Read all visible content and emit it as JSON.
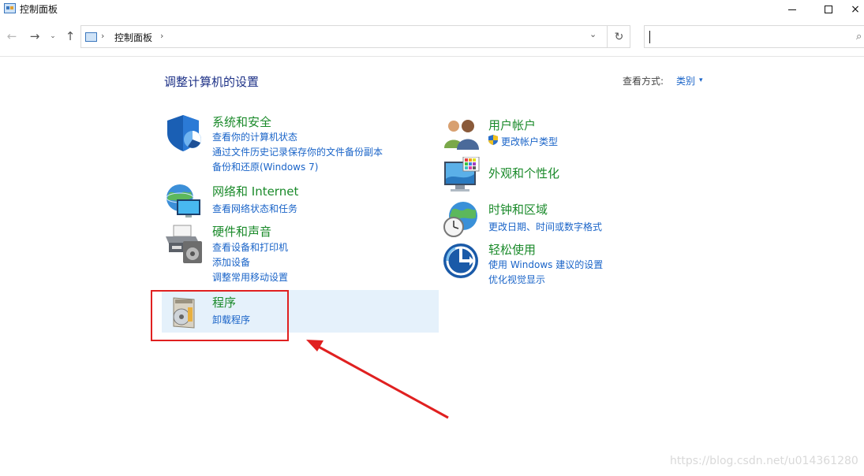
{
  "window": {
    "title": "控制面板",
    "minimize": "—",
    "close": "×"
  },
  "nav": {
    "back": "←",
    "forward": "→",
    "recent": "⌄",
    "up": "↑",
    "breadcrumb": "控制面板",
    "separator": "›",
    "dropdown": "⌄",
    "refresh": "↻",
    "search_placeholder": "",
    "search_icon": "⌕"
  },
  "content": {
    "page_title": "调整计算机的设置",
    "view_by_label": "查看方式:",
    "view_by_value": "类别",
    "view_by_arrow": "▾"
  },
  "categories_left": [
    {
      "title": "系统和安全",
      "icon": "shield-icon",
      "links": [
        "查看你的计算机状态",
        "通过文件历史记录保存你的文件备份副本",
        "备份和还原(Windows 7)"
      ]
    },
    {
      "title": "网络和 Internet",
      "icon": "network-icon",
      "links": [
        "查看网络状态和任务"
      ]
    },
    {
      "title": "硬件和声音",
      "icon": "printer-icon",
      "links": [
        "查看设备和打印机",
        "添加设备",
        "调整常用移动设置"
      ]
    },
    {
      "title": "程序",
      "icon": "programs-icon",
      "links": [
        "卸载程序"
      ]
    }
  ],
  "categories_right": [
    {
      "title": "用户帐户",
      "icon": "users-icon",
      "links": [
        "更改帐户类型"
      ]
    },
    {
      "title": "外观和个性化",
      "icon": "monitor-icon",
      "links": []
    },
    {
      "title": "时钟和区域",
      "icon": "clock-globe-icon",
      "links": [
        "更改日期、时间或数字格式"
      ]
    },
    {
      "title": "轻松使用",
      "icon": "accessibility-icon",
      "links": [
        "使用 Windows 建议的设置",
        "优化视觉显示"
      ]
    }
  ],
  "watermark": "https://blog.csdn.net/u014361280",
  "colors": {
    "category_title": "#1a8a2a",
    "link": "#1a64c8",
    "page_title": "#1e3287",
    "annotation": "#e02020",
    "highlight": "#e5f1fb"
  }
}
